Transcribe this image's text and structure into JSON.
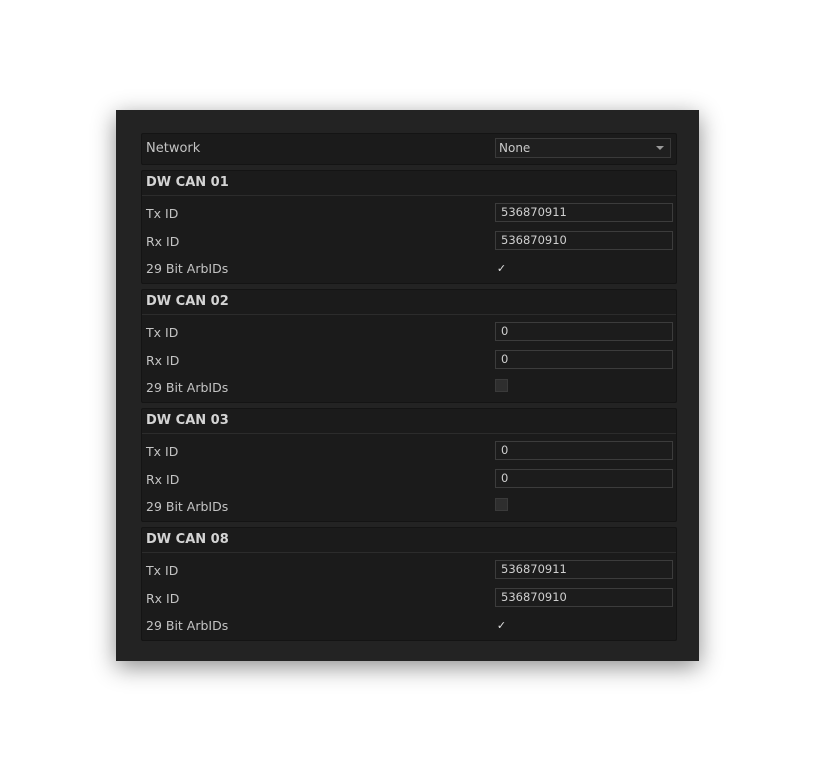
{
  "network": {
    "label": "Network",
    "selected": "None"
  },
  "groups": [
    {
      "title": "DW CAN 01",
      "tx_label": "Tx ID",
      "tx_value": "536870911",
      "rx_label": "Rx ID",
      "rx_value": "536870910",
      "bit_label": "29 Bit ArbIDs",
      "bit_checked": true,
      "check_glyph": "✓"
    },
    {
      "title": "DW CAN 02",
      "tx_label": "Tx ID",
      "tx_value": "0",
      "rx_label": "Rx ID",
      "rx_value": "0",
      "bit_label": "29 Bit ArbIDs",
      "bit_checked": false,
      "check_glyph": ""
    },
    {
      "title": "DW CAN 03",
      "tx_label": "Tx ID",
      "tx_value": "0",
      "rx_label": "Rx ID",
      "rx_value": "0",
      "bit_label": "29 Bit ArbIDs",
      "bit_checked": false,
      "check_glyph": ""
    },
    {
      "title": "DW CAN 08",
      "tx_label": "Tx ID",
      "tx_value": "536870911",
      "rx_label": "Rx ID",
      "rx_value": "536870910",
      "bit_label": "29 Bit ArbIDs",
      "bit_checked": true,
      "check_glyph": "✓"
    }
  ],
  "colors": {
    "window_bg": "#232323",
    "panel_bg": "#1b1b1b",
    "text": "#c4c4c4"
  },
  "icons": {
    "dropdown": "chevron-down-icon",
    "check": "checkmark-icon"
  }
}
